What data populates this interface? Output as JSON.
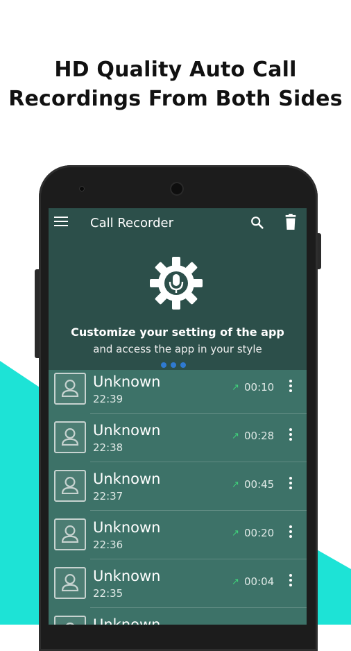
{
  "headline": {
    "line1": "HD Quality Auto Call",
    "line2": "Recordings From Both Sides"
  },
  "colors": {
    "accent": "#1de3d6",
    "appbar": "#2c4f4a",
    "list_bg": "#3d7268",
    "outgoing_arrow": "#3fd27a"
  },
  "app": {
    "title": "Call Recorder",
    "menu_icon": "hamburger-menu-icon",
    "search_icon": "search-icon",
    "delete_icon": "trash-icon"
  },
  "banner": {
    "icon": "gear-microphone-icon",
    "line1": "Customize your setting of the app",
    "line2": "and access the app in your style"
  },
  "recordings": [
    {
      "name": "Unknown",
      "time": "22:39",
      "direction": "outgoing",
      "arrow": "↗",
      "duration": "00:10"
    },
    {
      "name": "Unknown",
      "time": "22:38",
      "direction": "outgoing",
      "arrow": "↗",
      "duration": "00:28"
    },
    {
      "name": "Unknown",
      "time": "22:37",
      "direction": "outgoing",
      "arrow": "↗",
      "duration": "00:45"
    },
    {
      "name": "Unknown",
      "time": "22:36",
      "direction": "outgoing",
      "arrow": "↗",
      "duration": "00:20"
    },
    {
      "name": "Unknown",
      "time": "22:35",
      "direction": "outgoing",
      "arrow": "↗",
      "duration": "00:04"
    },
    {
      "name": "Unknown",
      "time": "",
      "direction": "",
      "arrow": "",
      "duration": ""
    }
  ]
}
